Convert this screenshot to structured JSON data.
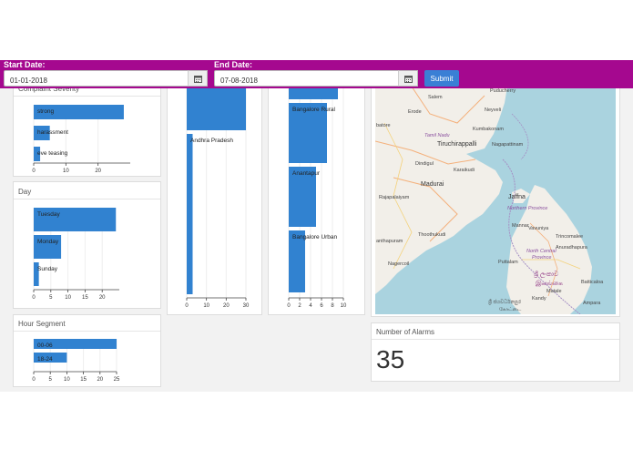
{
  "filters": {
    "start_label": "Start Date:",
    "start_value": "01-01-2018",
    "end_label": "End Date:",
    "end_value": "07-08-2018",
    "submit_label": "Submit",
    "calendar_icon": "calendar-icon"
  },
  "panels": {
    "complaint_severity": {
      "title": "Complaint Severity"
    },
    "day": {
      "title": "Day"
    },
    "hour_segment": {
      "title": "Hour Segment"
    },
    "alarms": {
      "title": "Number of Alarms",
      "value": "35"
    }
  },
  "map": {
    "labels": {
      "salem": "Salem",
      "puducherry": "Puducherry",
      "neyveli": "Neyveli",
      "erode": "Erode",
      "kumbakonam": "Kumbakonam",
      "batore": "batore",
      "tamil_nadu": "Tamil Nadu",
      "tiruchirappalli": "Tiruchirappalli",
      "nagapattinam": "Nagapattinam",
      "dindigul": "Dindigul",
      "karaikudi": "Karaikudi",
      "madurai": "Madurai",
      "rajapalaiyam": "Rajapalaiyam",
      "jaffna": "Jaffna",
      "northern_province": "Northern Province",
      "mannar": "Mannar",
      "vavuniya": "Vavuniya",
      "anthapuram": "anthapuram",
      "thoothukudi": "Thoothukudi",
      "trincomalee": "Trincomalee",
      "north_central": "North Central",
      "province": "Province",
      "nagercoil": "Nagercoil",
      "puttalam": "Puttalam",
      "anuradhapura": "Anuradhapura",
      "sri_lanka_si1": "ශ්‍රී ලංකාව",
      "sri_lanka_si2": "இலங்கை",
      "matale": "Matale",
      "kandy": "Kandy",
      "batticaloa": "Batticaloa",
      "ampara": "Ampara",
      "sl_bottom1": "ශ්‍රී ජයවර්ධනපුර",
      "sl_bottom2": "கோட்டை"
    }
  },
  "chart_data": [
    {
      "type": "bar",
      "orientation": "horizontal",
      "categories": [
        "strong",
        "harassment",
        "eve teasing"
      ],
      "values": [
        28,
        5,
        2
      ],
      "xlim": [
        0,
        30
      ],
      "x_ticks": [
        "0",
        "10",
        "20"
      ],
      "color": "#3182d0"
    },
    {
      "type": "bar",
      "orientation": "horizontal",
      "categories": [
        "",
        "Andhra Pradesh"
      ],
      "values": [
        30,
        3
      ],
      "xlim": [
        0,
        30
      ],
      "x_ticks": [
        "0",
        "10",
        "20",
        "30"
      ],
      "color": "#3182d0"
    },
    {
      "type": "bar",
      "orientation": "horizontal",
      "categories": [
        "",
        "Bangalore Rural",
        "Anantapur",
        "Bangalore Urban"
      ],
      "values": [
        9,
        7,
        5,
        3
      ],
      "xlim": [
        0,
        10
      ],
      "x_ticks": [
        "0",
        "2",
        "4",
        "6",
        "8",
        "10"
      ],
      "color": "#3182d0"
    },
    {
      "type": "bar",
      "orientation": "horizontal",
      "categories": [
        "Tuesday",
        "Monday",
        "Sunday"
      ],
      "values": [
        24,
        8,
        1.5
      ],
      "xlim": [
        0,
        25
      ],
      "x_ticks": [
        "0",
        "5",
        "10",
        "15",
        "20"
      ],
      "color": "#3182d0"
    },
    {
      "type": "bar",
      "orientation": "horizontal",
      "categories": [
        "00-06",
        "18-24"
      ],
      "values": [
        25,
        10
      ],
      "xlim": [
        0,
        25
      ],
      "x_ticks": [
        "0",
        "5",
        "10",
        "15",
        "20",
        "25"
      ],
      "color": "#3182d0"
    }
  ]
}
